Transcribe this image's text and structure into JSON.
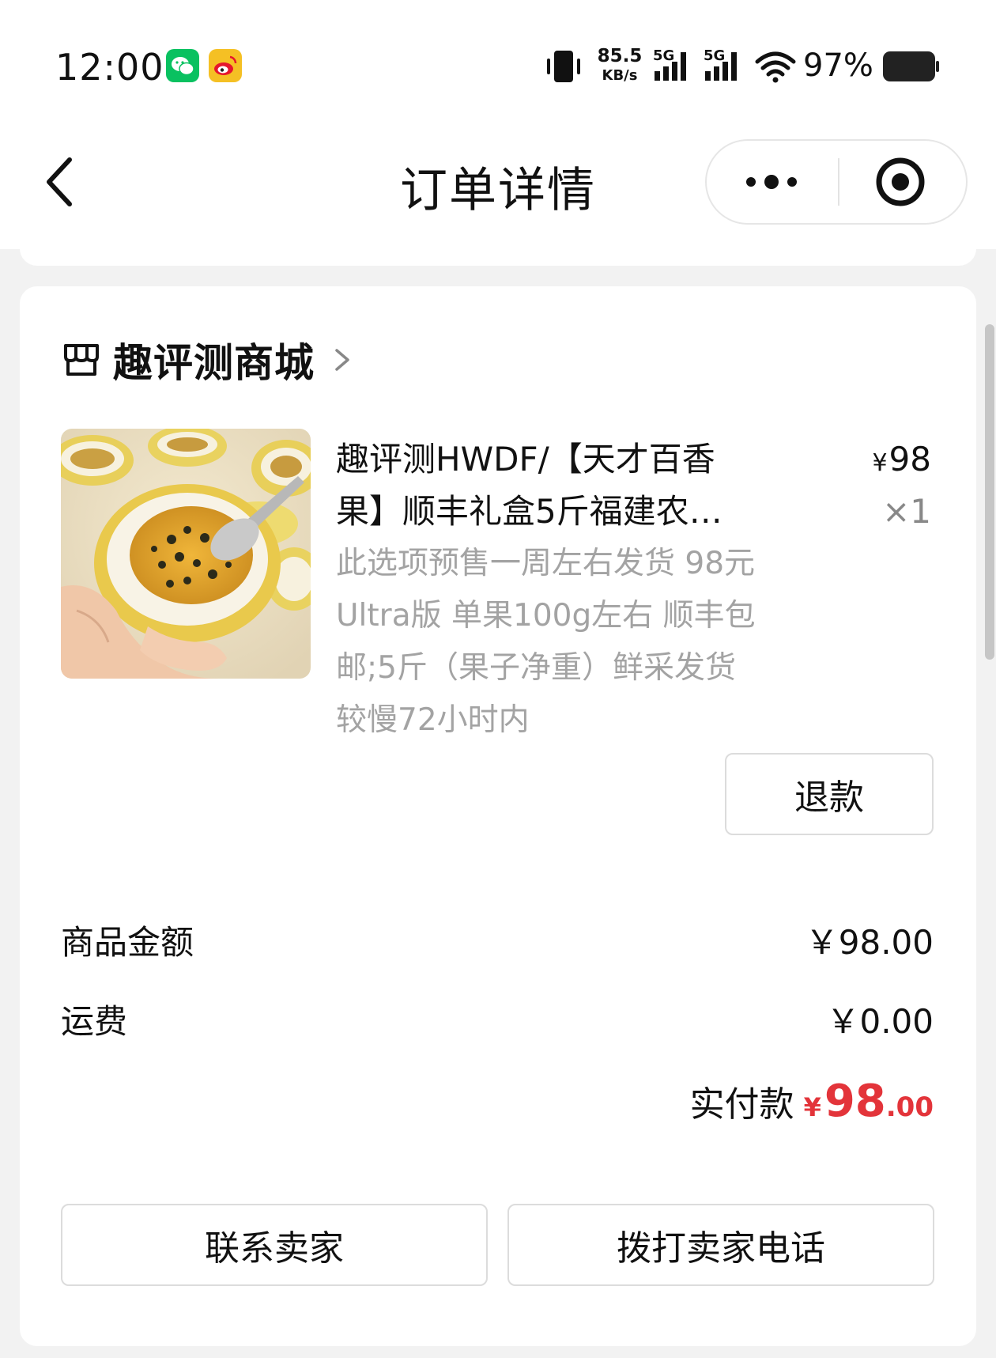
{
  "status_bar": {
    "time": "12:00",
    "net_speed_value": "85.5",
    "net_speed_unit": "KB/s",
    "signal_1_tag": "5G",
    "signal_2_tag": "5G",
    "battery": "97%",
    "icons": [
      "wechat-icon",
      "weibo-icon",
      "vibrate-icon",
      "signal-icon",
      "wifi-icon",
      "battery-icon"
    ]
  },
  "nav": {
    "title": "订单详情",
    "back_icon": "chevron-left-icon",
    "more_icon": "more-dots-icon",
    "close_icon": "target-circle-icon"
  },
  "order": {
    "shop_name": "趣评测商城",
    "product": {
      "title_line1": "趣评测HWDF/【天才百香",
      "title_line2": "果】顺丰礼盒5斤福建农…",
      "spec_lines": [
        "此选项预售一周左右发货 98元",
        "Ultra版 单果100g左右 顺丰包",
        "邮;5斤（果子净重）鲜采发货",
        "较慢72小时内"
      ],
      "price_symbol": "¥",
      "price": "98",
      "quantity": "×1"
    },
    "refund_label": "退款",
    "summary": {
      "goods_label": "商品金额",
      "goods_amount": "￥98.00",
      "shipping_label": "运费",
      "shipping_amount": "￥0.00",
      "paid_label": "实付款",
      "paid_symbol": "¥",
      "paid_integer": "98",
      "paid_decimal": ".00"
    },
    "actions": {
      "contact_label": "联系卖家",
      "call_label": "拨打卖家电话"
    }
  },
  "colors": {
    "accent_red": "#e3343a",
    "background": "#f2f2f2",
    "muted_text": "#a3a3a3",
    "wechat_green": "#09c160",
    "weibo_yellow": "#f5c024"
  }
}
